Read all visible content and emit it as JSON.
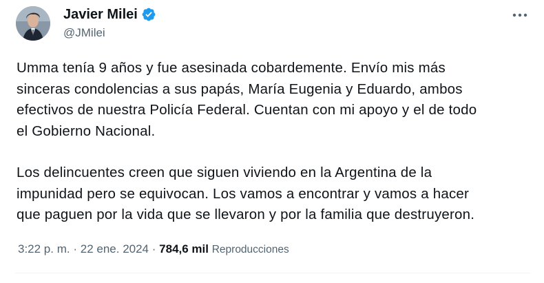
{
  "author": {
    "display_name": "Javier Milei",
    "handle": "@JMilei",
    "verified": true
  },
  "tweet": {
    "paragraph1": [
      "Umma tenía 9 años y fue asesinada cobardemente. Envío mis más",
      "sinceras condolencias a sus papás, María Eugenia y Eduardo, ambos",
      "efectivos de nuestra Policía Federal. Cuentan con mi apoyo y el de todo",
      "el Gobierno Nacional."
    ],
    "paragraph2": [
      "Los delincuentes creen que siguen viviendo en la Argentina de la",
      "impunidad pero se equivocan. Los vamos a encontrar y vamos a hacer",
      "que paguen por la vida que se llevaron y por la familia que destruyeron."
    ]
  },
  "meta": {
    "time": "3:22 p. m.",
    "separator": "·",
    "date": "22 ene. 2024",
    "views_count": "784,6 mil",
    "views_label": "Reproducciones"
  },
  "icons": {
    "more": "more-horizontal-icon",
    "verified": "verified-badge-icon"
  },
  "colors": {
    "text": "#0f1419",
    "secondary": "#536471",
    "verified": "#1d9bf0"
  }
}
